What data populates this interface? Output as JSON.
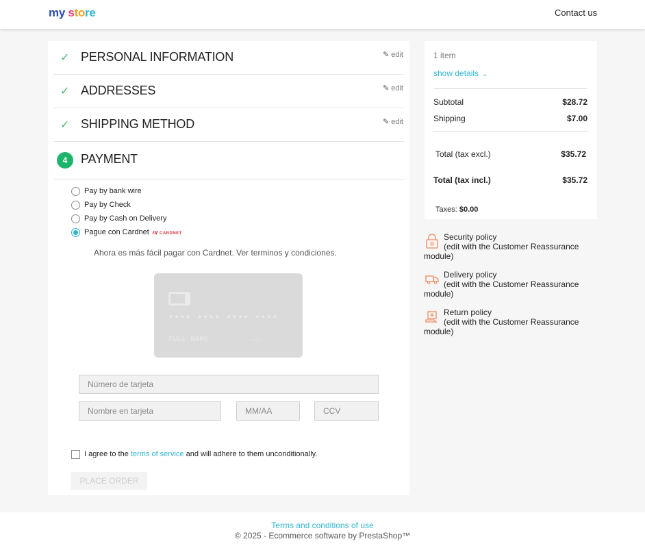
{
  "header": {
    "logo": {
      "my": "my",
      "s": "s",
      "to": "to",
      "re": "re"
    },
    "contact": "Contact us"
  },
  "steps": [
    {
      "title": "PERSONAL INFORMATION",
      "edit": "edit"
    },
    {
      "title": "ADDRESSES",
      "edit": "edit"
    },
    {
      "title": "SHIPPING METHOD",
      "edit": "edit"
    },
    {
      "number": "4",
      "title": "PAYMENT"
    }
  ],
  "payment": {
    "options": [
      {
        "label": "Pay by bank wire",
        "selected": false
      },
      {
        "label": "Pay by Check",
        "selected": false
      },
      {
        "label": "Pay by Cash on Delivery",
        "selected": false
      },
      {
        "label": "Pague con Cardnet",
        "selected": true
      }
    ],
    "cardnet_logo": "CARDNET",
    "info": "Ahora es más fácil pagar con Cardnet. Ver terminos y condiciones.",
    "card": {
      "number_mask": "•••• •••• •••• ••••",
      "full_name": "FULL NAME",
      "expiry_mask": "••/••"
    },
    "fields": {
      "card_number_placeholder": "Número de tarjeta",
      "card_name_placeholder": "Nombre en tarjeta",
      "expiry_placeholder": "MM/AA",
      "cvv_placeholder": "CCV"
    },
    "agree": {
      "before": "I agree to the ",
      "link": "terms of service",
      "after": " and will adhere to them unconditionally."
    },
    "place_order": "PLACE ORDER"
  },
  "summary": {
    "items": "1 item",
    "show_details": "show details",
    "subtotal_label": "Subtotal",
    "subtotal_value": "$28.72",
    "shipping_label": "Shipping",
    "shipping_value": "$7.00",
    "total_excl_label": "Total (tax excl.)",
    "total_excl_value": "$35.72",
    "total_incl_label": "Total (tax incl.)",
    "total_incl_value": "$35.72",
    "taxes_label": "Taxes: ",
    "taxes_value": "$0.00"
  },
  "reassurance": [
    {
      "title": "Security policy",
      "line2": "(edit with the Customer Reassurance",
      "line3": "module)",
      "icon": "lock-icon"
    },
    {
      "title": "Delivery policy",
      "line2": "(edit with the Customer Reassurance",
      "line3": "module)",
      "icon": "truck-icon"
    },
    {
      "title": "Return policy",
      "line2": "(edit with the Customer Reassurance",
      "line3": "module)",
      "icon": "return-box-icon"
    }
  ],
  "footer": {
    "link": "Terms and conditions of use",
    "copyright": "© 2025 - Ecommerce software by PrestaShop™"
  },
  "colors": {
    "accent": "#2fb5d2",
    "check": "#4cbb6c",
    "step_active": "#1fb46b",
    "reassurance_icon": "#f08a5d"
  }
}
